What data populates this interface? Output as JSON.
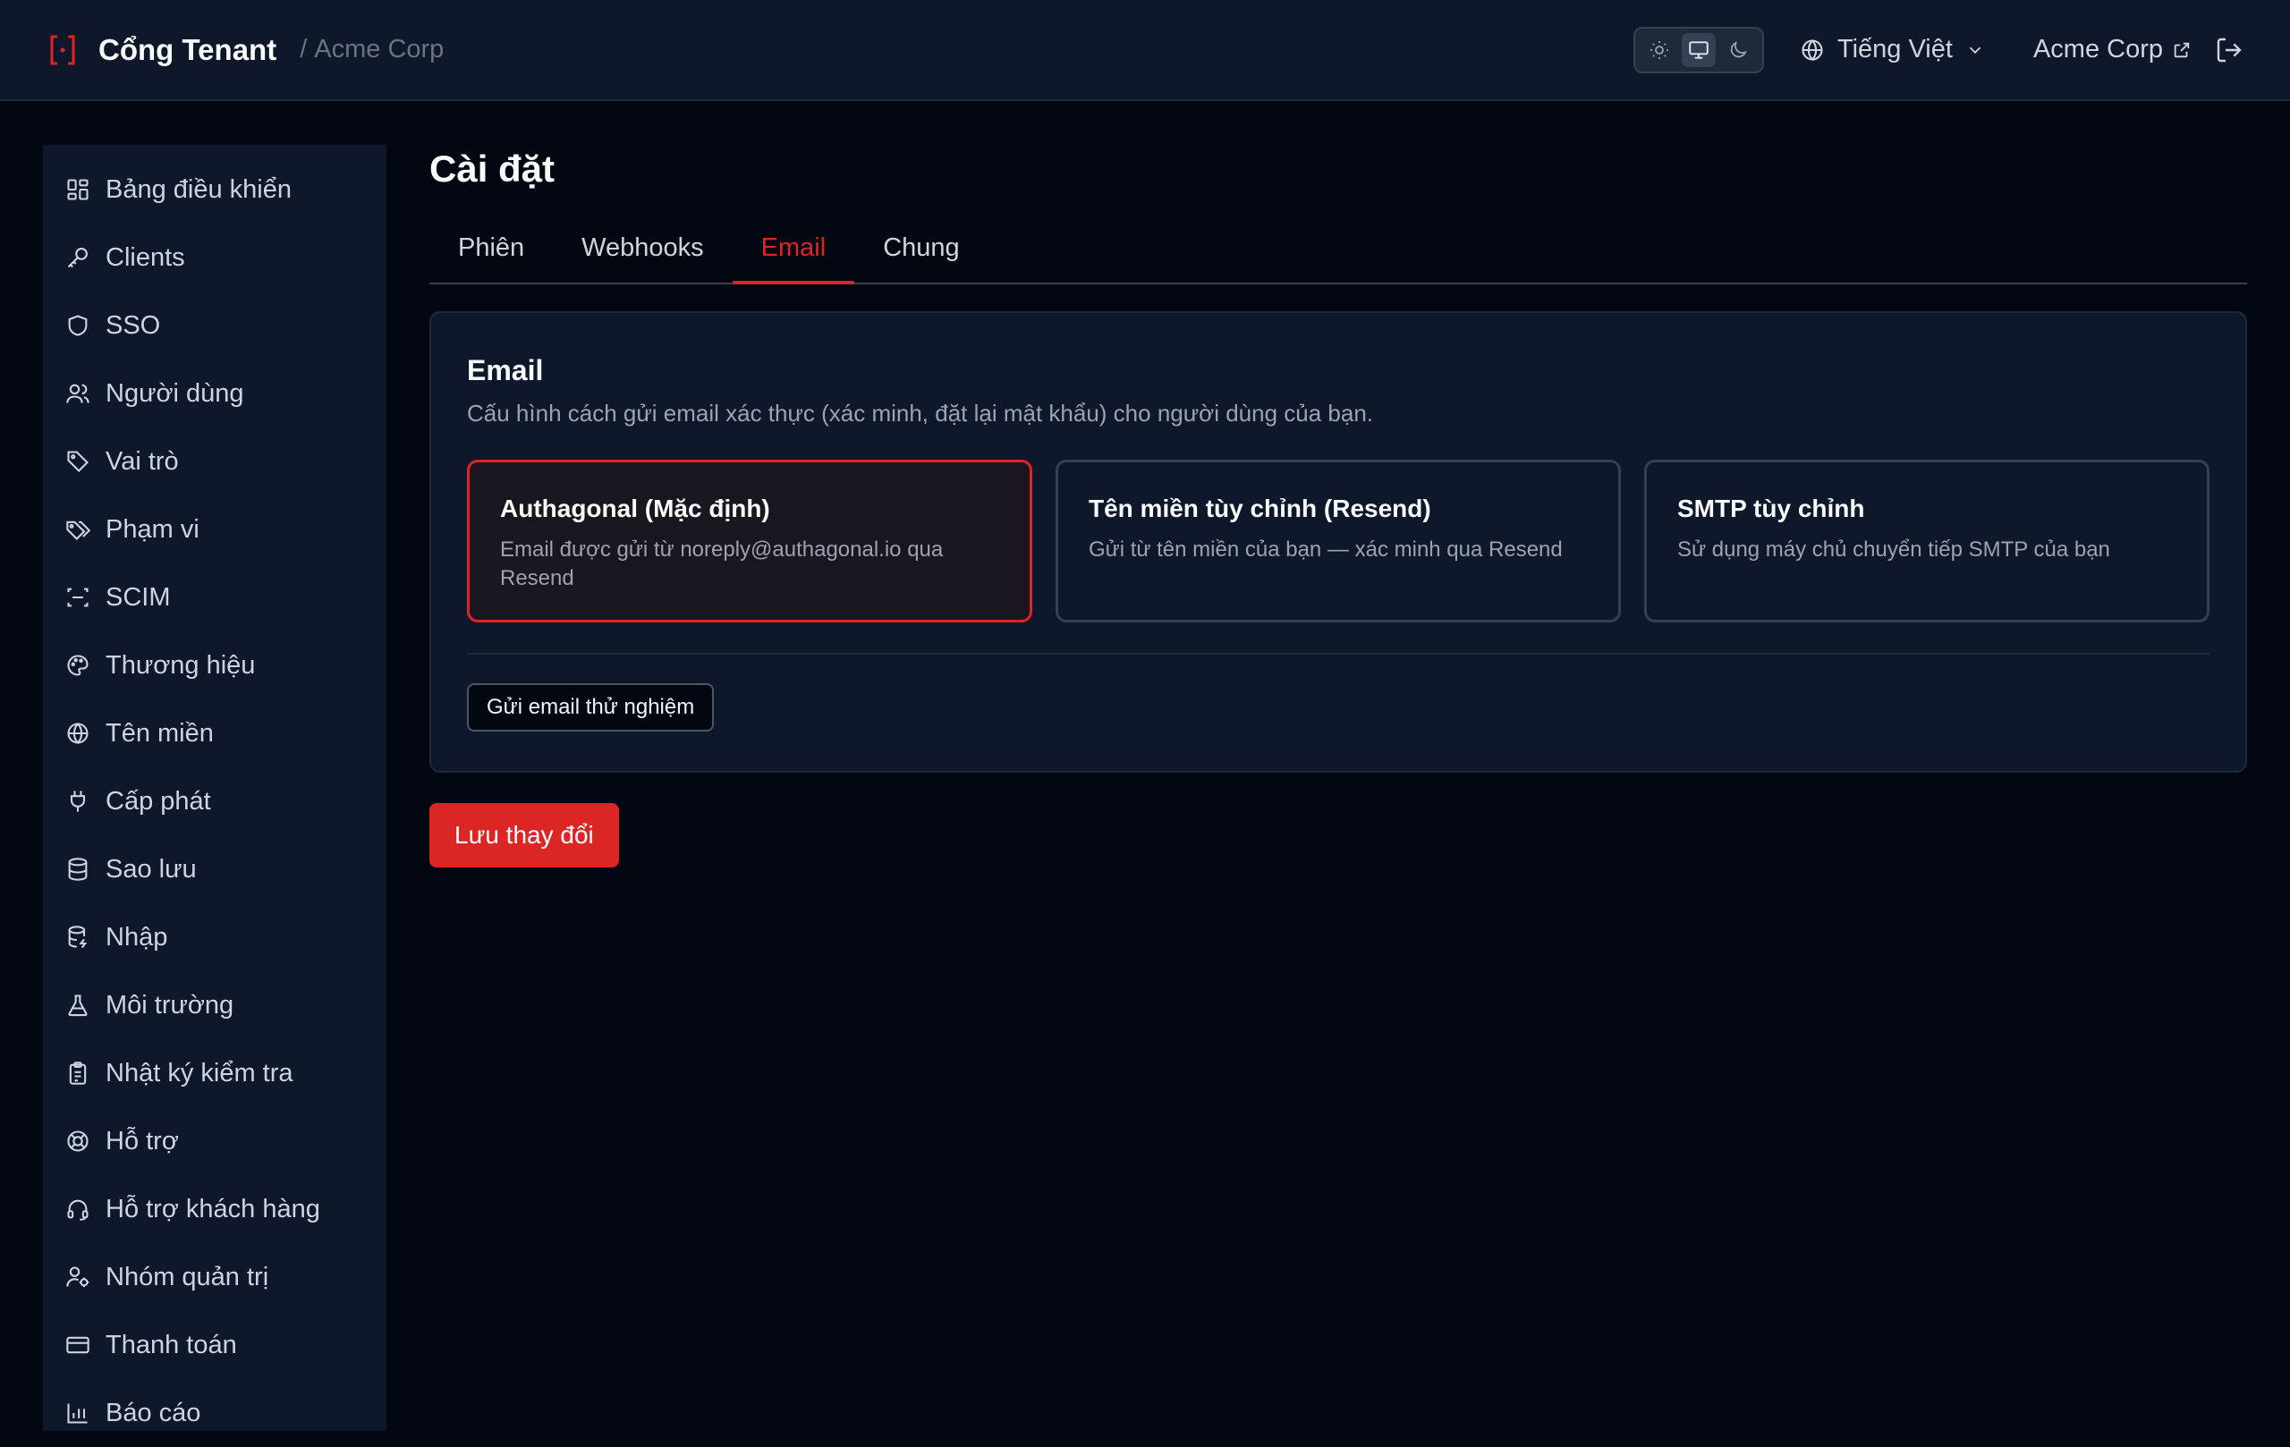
{
  "header": {
    "brand_name": "Cổng Tenant",
    "separator": "/",
    "tenant_name": "Acme Corp",
    "language": "Tiếng Việt",
    "tenant_link": "Acme Corp"
  },
  "sidebar": {
    "items": [
      {
        "label": "Bảng điều khiển",
        "icon": "dashboard-icon"
      },
      {
        "label": "Clients",
        "icon": "key-icon"
      },
      {
        "label": "SSO",
        "icon": "shield-icon"
      },
      {
        "label": "Người dùng",
        "icon": "users-icon"
      },
      {
        "label": "Vai trò",
        "icon": "tag-icon"
      },
      {
        "label": "Phạm vi",
        "icon": "tags-icon"
      },
      {
        "label": "SCIM",
        "icon": "scan-icon"
      },
      {
        "label": "Thương hiệu",
        "icon": "palette-icon"
      },
      {
        "label": "Tên miền",
        "icon": "globe-icon"
      },
      {
        "label": "Cấp phát",
        "icon": "plug-icon"
      },
      {
        "label": "Sao lưu",
        "icon": "database-icon"
      },
      {
        "label": "Nhập",
        "icon": "database-import-icon"
      },
      {
        "label": "Môi trường",
        "icon": "flask-icon"
      },
      {
        "label": "Nhật ký kiểm tra",
        "icon": "clipboard-icon"
      },
      {
        "label": "Hỗ trợ",
        "icon": "lifebuoy-icon"
      },
      {
        "label": "Hỗ trợ khách hàng",
        "icon": "headset-icon"
      },
      {
        "label": "Nhóm quản trị",
        "icon": "user-cog-icon"
      },
      {
        "label": "Thanh toán",
        "icon": "credit-card-icon"
      },
      {
        "label": "Báo cáo",
        "icon": "bar-chart-icon"
      }
    ]
  },
  "main": {
    "title": "Cài đặt",
    "tabs": [
      {
        "label": "Phiên"
      },
      {
        "label": "Webhooks"
      },
      {
        "label": "Email",
        "active": true
      },
      {
        "label": "Chung"
      }
    ],
    "card": {
      "title": "Email",
      "description": "Cấu hình cách gửi email xác thực (xác minh, đặt lại mật khẩu) cho người dùng của bạn.",
      "options": [
        {
          "title": "Authagonal (Mặc định)",
          "description": "Email được gửi từ noreply@authagonal.io qua Resend",
          "selected": true
        },
        {
          "title": "Tên miền tùy chỉnh (Resend)",
          "description": "Gửi từ tên miền của bạn — xác minh qua Resend"
        },
        {
          "title": "SMTP tùy chỉnh",
          "description": "Sử dụng máy chủ chuyển tiếp SMTP của bạn"
        }
      ],
      "test_button": "Gửi email thử nghiệm"
    },
    "save_button": "Lưu thay đổi"
  },
  "colors": {
    "accent": "#dc2626",
    "background": "#030712",
    "panel": "#0f172a"
  }
}
